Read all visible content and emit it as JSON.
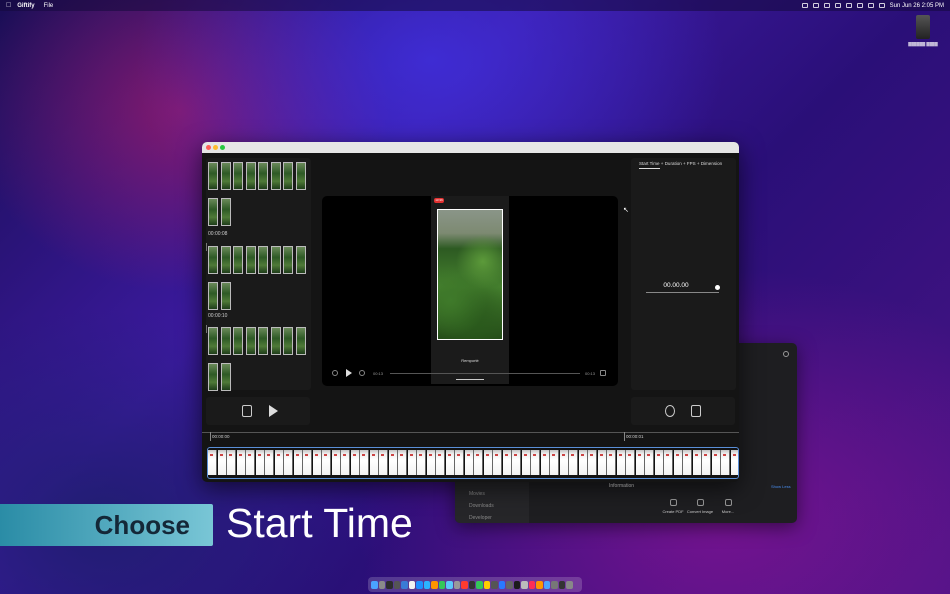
{
  "menubar": {
    "app_name": "Giftify",
    "menu_file": "File",
    "clock": "Sun Jun 26  2:05 PM"
  },
  "left_panel": {
    "time_labels": [
      "00:00:08",
      "00:00:10"
    ]
  },
  "preview": {
    "recording_badge": "13:36",
    "remember_label": "Remporté",
    "time_start": "00:13",
    "time_end": "00:13"
  },
  "right_panel": {
    "tab_start": "Start Time",
    "tab_duration": "Duration",
    "tab_fps": "FPS",
    "tab_dimension": "Dimension",
    "tab_sep": "+",
    "time_value": "00.00.00"
  },
  "ruler": {
    "start": "00:00:00",
    "mark": "00:00:01"
  },
  "background_window": {
    "sidebar_items": [
      "Movies",
      "Downloads",
      "Developer"
    ],
    "info_heading": "Information",
    "show_less": "Show Less",
    "toolbar": [
      "Create PDF",
      "Convert Image",
      "More..."
    ]
  },
  "caption": {
    "box_text": "Choose",
    "main_text": "Start Time"
  },
  "colors": {
    "caption_box": "#5ab6cb",
    "selection_border": "#5a8fd8",
    "window_bg": "#141414"
  }
}
